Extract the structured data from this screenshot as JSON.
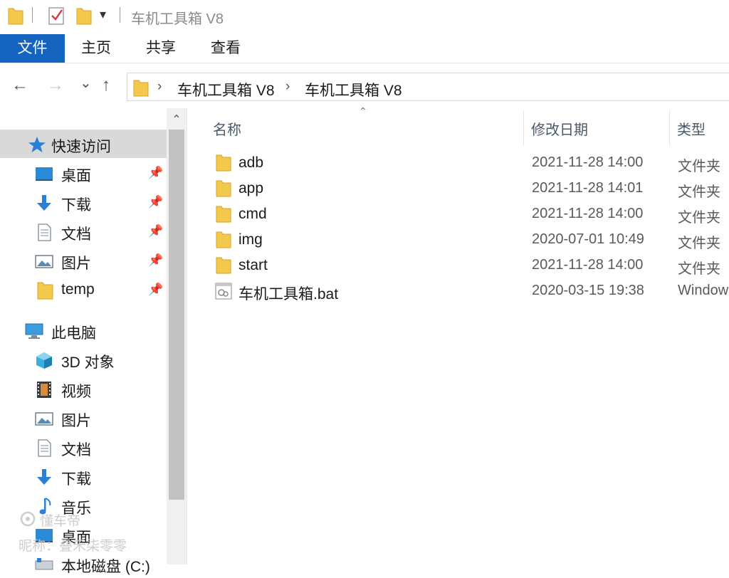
{
  "window": {
    "title": "车机工具箱 V8",
    "quick_access_dropdown": "▾"
  },
  "ribbon": {
    "tabs": [
      {
        "label": "文件",
        "active": true
      },
      {
        "label": "主页"
      },
      {
        "label": "共享"
      },
      {
        "label": "查看"
      }
    ]
  },
  "address": {
    "back": "←",
    "forward": "→",
    "recent": "⌄",
    "up": "↑",
    "breadcrumbs": [
      "车机工具箱 V8",
      "车机工具箱 V8"
    ],
    "separator": "›"
  },
  "nav": {
    "quick_access": "快速访问",
    "pinned": [
      {
        "label": "桌面",
        "icon": "desktop-icon"
      },
      {
        "label": "下载",
        "icon": "download-icon"
      },
      {
        "label": "文档",
        "icon": "document-icon"
      },
      {
        "label": "图片",
        "icon": "picture-icon"
      },
      {
        "label": "temp",
        "icon": "folder-icon"
      }
    ],
    "this_pc": "此电脑",
    "pc_items": [
      {
        "label": "3D 对象",
        "icon": "3d-objects-icon"
      },
      {
        "label": "视频",
        "icon": "video-icon"
      },
      {
        "label": "图片",
        "icon": "picture-icon"
      },
      {
        "label": "文档",
        "icon": "document-icon"
      },
      {
        "label": "下载",
        "icon": "download-icon"
      },
      {
        "label": "音乐",
        "icon": "music-icon"
      },
      {
        "label": "桌面",
        "icon": "desktop-icon"
      },
      {
        "label": "本地磁盘 (C:)",
        "icon": "drive-icon"
      }
    ],
    "pin_glyph": "📌",
    "scroll_up": "⌃"
  },
  "columns": {
    "name": "名称",
    "date": "修改日期",
    "type": "类型",
    "sort_glyph": "⌃"
  },
  "files": [
    {
      "name": "adb",
      "date": "2021-11-28 14:00",
      "type": "文件夹",
      "icon": "folder-icon"
    },
    {
      "name": "app",
      "date": "2021-11-28 14:01",
      "type": "文件夹",
      "icon": "folder-icon"
    },
    {
      "name": "cmd",
      "date": "2021-11-28 14:00",
      "type": "文件夹",
      "icon": "folder-icon"
    },
    {
      "name": "img",
      "date": "2020-07-01 10:49",
      "type": "文件夹",
      "icon": "folder-icon"
    },
    {
      "name": "start",
      "date": "2021-11-28 14:00",
      "type": "文件夹",
      "icon": "folder-icon"
    },
    {
      "name": "车机工具箱.bat",
      "date": "2020-03-15 19:38",
      "type": "Window",
      "icon": "batch-file-icon"
    }
  ],
  "watermark": {
    "brand": "懂车帝",
    "nickname": "昵称：叠禾柒零零"
  },
  "colors": {
    "accent": "#1565c0",
    "folder": "#f2c94c",
    "selected": "#d9d9d9"
  }
}
